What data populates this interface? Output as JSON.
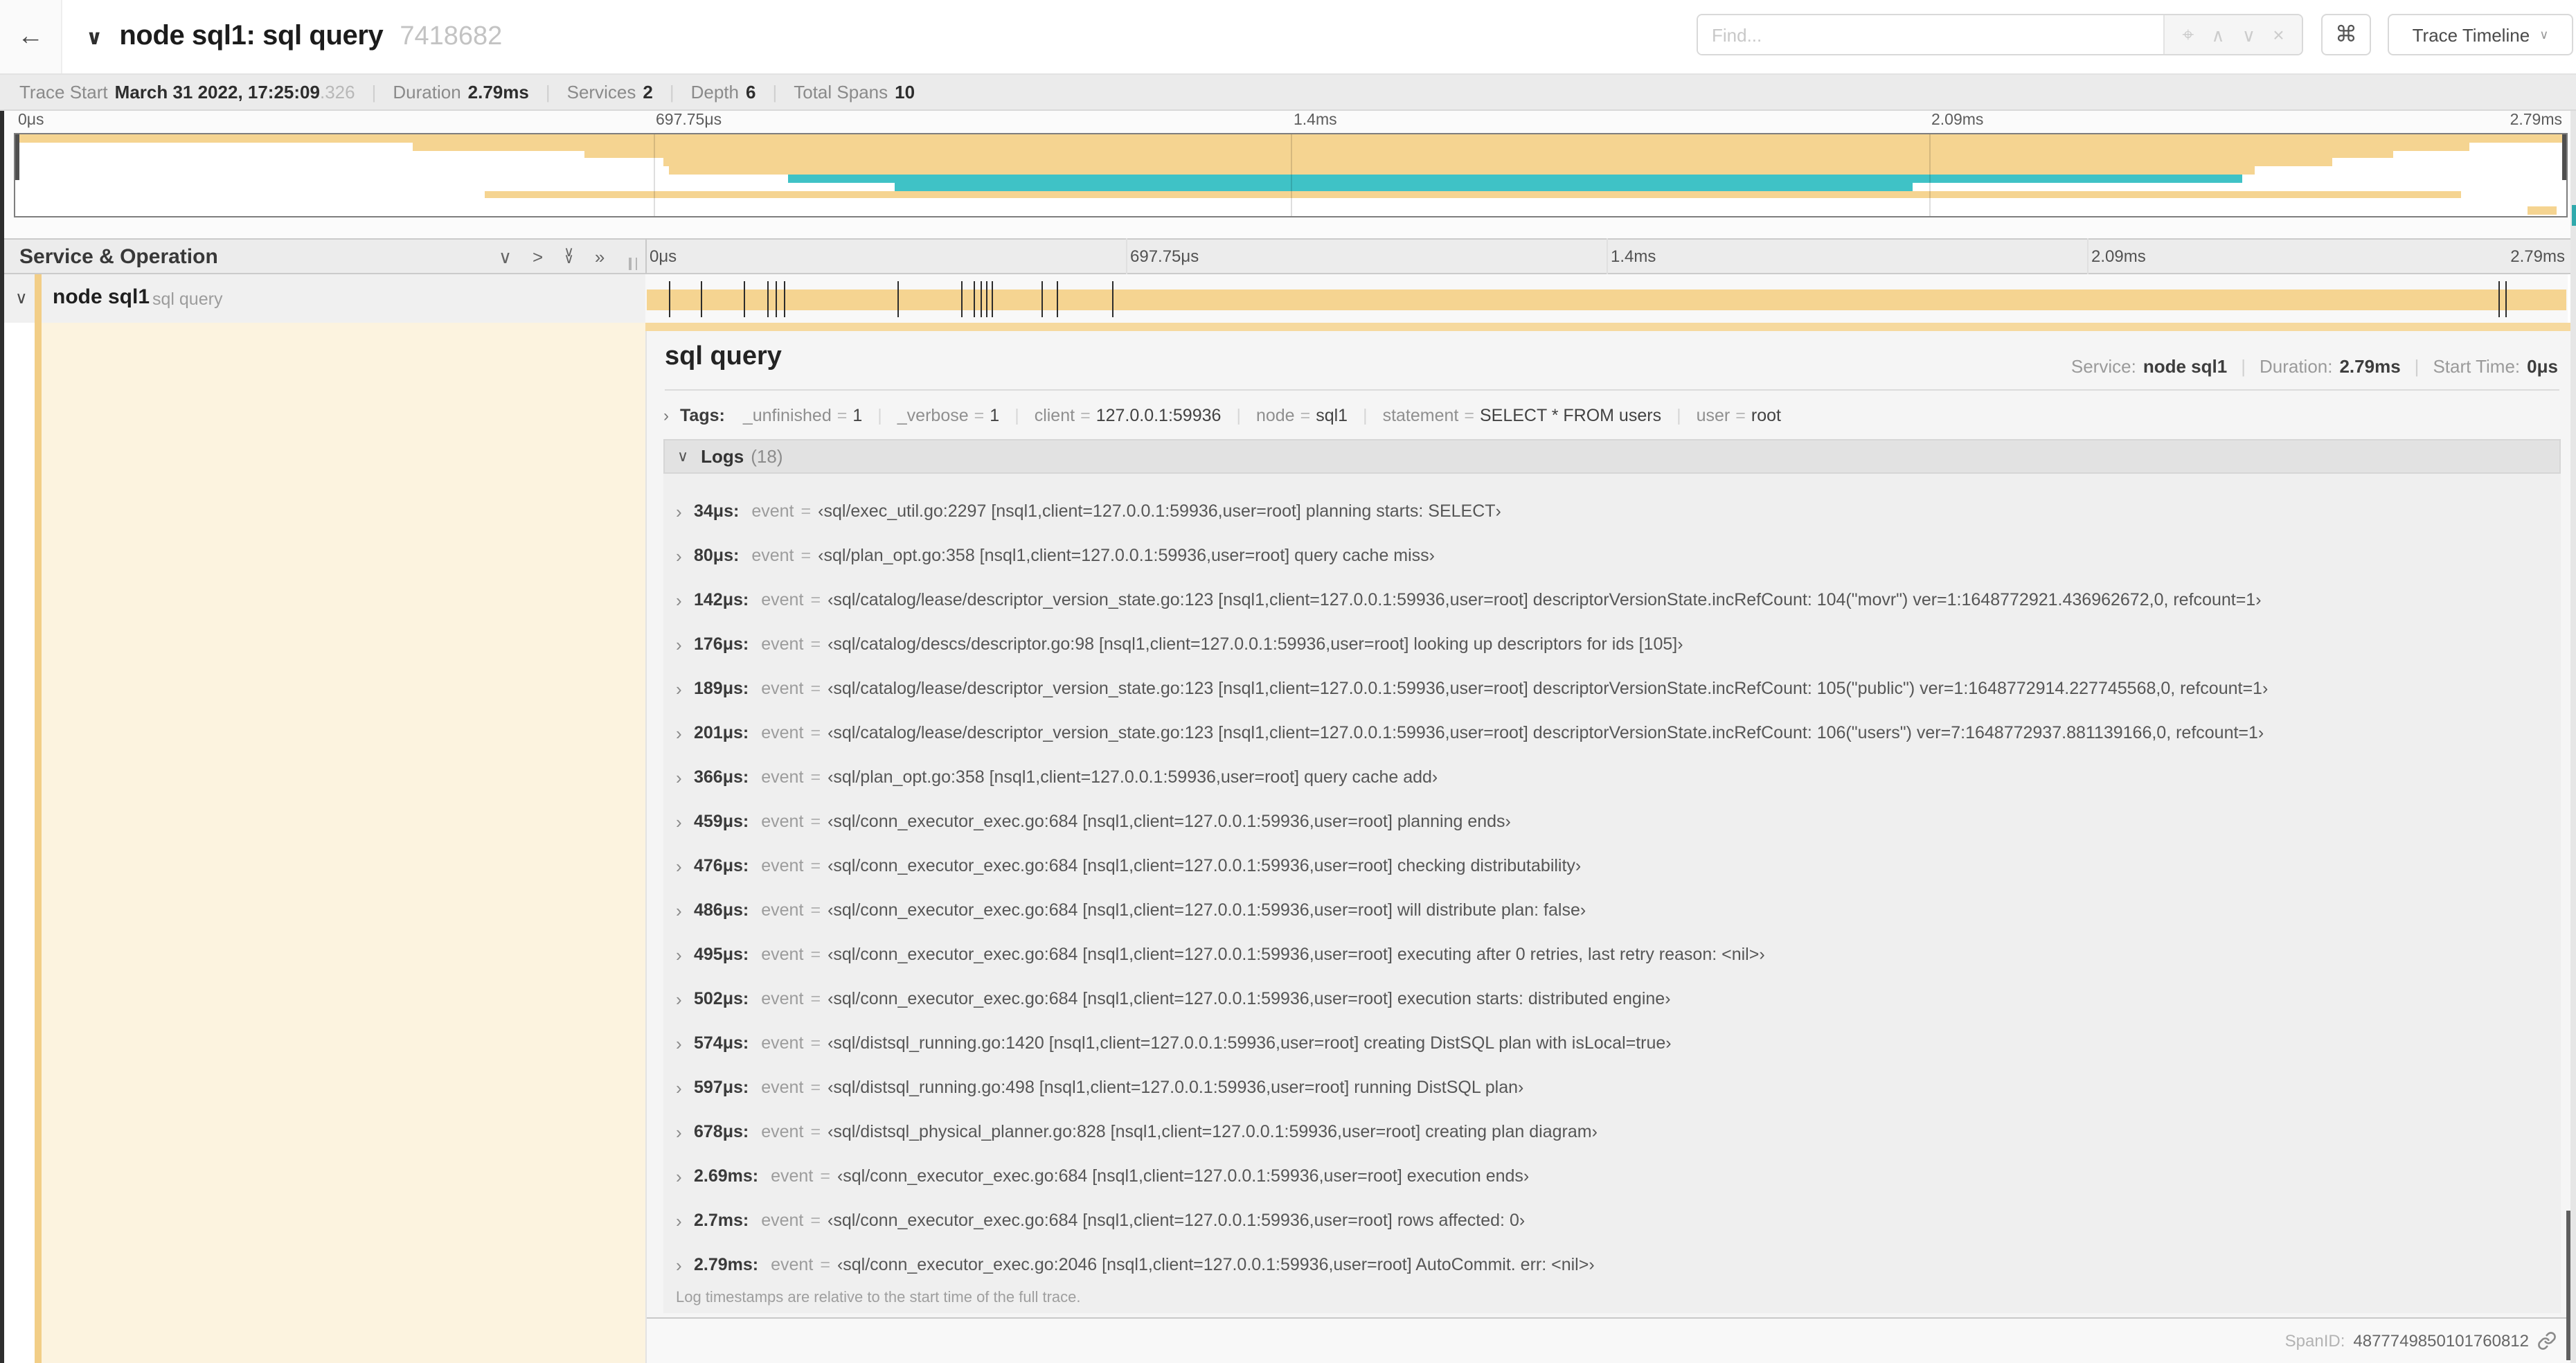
{
  "icons": {
    "back": "←",
    "collapse": "∨",
    "chevron_right": "›",
    "expand_right": ">",
    "double_chevron_right": "»",
    "locate": "⌖",
    "up_chevron": "∧",
    "down_chevron": "∨",
    "close": "×",
    "command": "⌘",
    "caret": "∨"
  },
  "header": {
    "title": "node sql1: sql query",
    "trace_id": "7418682",
    "find_placeholder": "Find...",
    "view_selector_label": "Trace Timeline"
  },
  "summary": {
    "items": [
      {
        "label": "Trace Start",
        "value": "March 31 2022, 17:25:09",
        "suffix": ".326"
      },
      {
        "label": "Duration",
        "value": "2.79ms",
        "suffix": ""
      },
      {
        "label": "Services",
        "value": "2",
        "suffix": ""
      },
      {
        "label": "Depth",
        "value": "6",
        "suffix": ""
      },
      {
        "label": "Total Spans",
        "value": "10",
        "suffix": ""
      }
    ]
  },
  "timeline": {
    "duration_us": 2790,
    "tick_labels": [
      "0μs",
      "697.75μs",
      "1.4ms",
      "2.09ms",
      "2.79ms"
    ],
    "log_marks_us": [
      34,
      80,
      142,
      176,
      189,
      201,
      366,
      459,
      476,
      486,
      495,
      502,
      574,
      597,
      678,
      2690,
      2700
    ]
  },
  "minimap": {
    "rows": [
      {
        "s": 0.0,
        "e": 1.0,
        "c": "tan"
      },
      {
        "s": 0.156,
        "e": 0.962,
        "c": "tan"
      },
      {
        "s": 0.223,
        "e": 0.932,
        "c": "tan"
      },
      {
        "s": 0.254,
        "e": 0.908,
        "c": "tan"
      },
      {
        "s": 0.256,
        "e": 0.878,
        "c": "tan"
      },
      {
        "s": 0.303,
        "e": 0.873,
        "c": "teal"
      },
      {
        "s": 0.345,
        "e": 0.744,
        "c": "teal"
      },
      {
        "s": 0.184,
        "e": 0.959,
        "c": "tan"
      },
      {
        "s": 0.0,
        "e": 0.0,
        "c": "none"
      },
      {
        "s": 0.985,
        "e": 0.996,
        "c": "tan"
      }
    ]
  },
  "grid": {
    "left_header_title": "Service & Operation"
  },
  "span_row": {
    "service": "node sql1",
    "operation": "sql query"
  },
  "detail": {
    "title": "sql query",
    "eq_sign": "=",
    "meta": [
      {
        "label": "Service:",
        "value": "node sql1"
      },
      {
        "label": "Duration:",
        "value": "2.79ms"
      },
      {
        "label": "Start Time:",
        "value": "0μs"
      }
    ],
    "tags_label": "Tags:",
    "tags": [
      {
        "key": "_unfinished",
        "value": "1"
      },
      {
        "key": "_verbose",
        "value": "1"
      },
      {
        "key": "client",
        "value": "127.0.0.1:59936"
      },
      {
        "key": "node",
        "value": "sql1"
      },
      {
        "key": "statement",
        "value": "SELECT * FROM users"
      },
      {
        "key": "user",
        "value": "root"
      }
    ],
    "logs_label": "Logs",
    "logs_count": "(18)",
    "log_field": "event",
    "logs": [
      {
        "time": "34μs:",
        "value": "‹sql/exec_util.go:2297 [nsql1,client=127.0.0.1:59936,user=root] planning starts: SELECT›"
      },
      {
        "time": "80μs:",
        "value": "‹sql/plan_opt.go:358 [nsql1,client=127.0.0.1:59936,user=root] query cache miss›"
      },
      {
        "time": "142μs:",
        "value": "‹sql/catalog/lease/descriptor_version_state.go:123 [nsql1,client=127.0.0.1:59936,user=root] descriptorVersionState.incRefCount: 104(\"movr\") ver=1:1648772921.436962672,0, refcount=1›"
      },
      {
        "time": "176μs:",
        "value": "‹sql/catalog/descs/descriptor.go:98 [nsql1,client=127.0.0.1:59936,user=root] looking up descriptors for ids [105]›"
      },
      {
        "time": "189μs:",
        "value": "‹sql/catalog/lease/descriptor_version_state.go:123 [nsql1,client=127.0.0.1:59936,user=root] descriptorVersionState.incRefCount: 105(\"public\") ver=1:1648772914.227745568,0, refcount=1›"
      },
      {
        "time": "201μs:",
        "value": "‹sql/catalog/lease/descriptor_version_state.go:123 [nsql1,client=127.0.0.1:59936,user=root] descriptorVersionState.incRefCount: 106(\"users\") ver=7:1648772937.881139166,0, refcount=1›"
      },
      {
        "time": "366μs:",
        "value": "‹sql/plan_opt.go:358 [nsql1,client=127.0.0.1:59936,user=root] query cache add›"
      },
      {
        "time": "459μs:",
        "value": "‹sql/conn_executor_exec.go:684 [nsql1,client=127.0.0.1:59936,user=root] planning ends›"
      },
      {
        "time": "476μs:",
        "value": "‹sql/conn_executor_exec.go:684 [nsql1,client=127.0.0.1:59936,user=root] checking distributability›"
      },
      {
        "time": "486μs:",
        "value": "‹sql/conn_executor_exec.go:684 [nsql1,client=127.0.0.1:59936,user=root] will distribute plan: false›"
      },
      {
        "time": "495μs:",
        "value": "‹sql/conn_executor_exec.go:684 [nsql1,client=127.0.0.1:59936,user=root] executing after 0 retries, last retry reason: <nil>›"
      },
      {
        "time": "502μs:",
        "value": "‹sql/conn_executor_exec.go:684 [nsql1,client=127.0.0.1:59936,user=root] execution starts: distributed engine›"
      },
      {
        "time": "574μs:",
        "value": "‹sql/distsql_running.go:1420 [nsql1,client=127.0.0.1:59936,user=root] creating DistSQL plan with isLocal=true›"
      },
      {
        "time": "597μs:",
        "value": "‹sql/distsql_running.go:498 [nsql1,client=127.0.0.1:59936,user=root] running DistSQL plan›"
      },
      {
        "time": "678μs:",
        "value": "‹sql/distsql_physical_planner.go:828 [nsql1,client=127.0.0.1:59936,user=root] creating plan diagram›"
      },
      {
        "time": "2.69ms:",
        "value": "‹sql/conn_executor_exec.go:684 [nsql1,client=127.0.0.1:59936,user=root] execution ends›"
      },
      {
        "time": "2.7ms:",
        "value": "‹sql/conn_executor_exec.go:684 [nsql1,client=127.0.0.1:59936,user=root] rows affected: 0›"
      },
      {
        "time": "2.79ms:",
        "value": "‹sql/conn_executor_exec.go:2046 [nsql1,client=127.0.0.1:59936,user=root] AutoCommit. err: <nil>›"
      }
    ],
    "logs_footnote": "Log timestamps are relative to the start time of the full trace.",
    "span_id_label": "SpanID:",
    "span_id": "4877749850101760812"
  },
  "colors": {
    "tan": "#F5D491",
    "teal": "#3FC2C6",
    "cream": "#FCF3DF",
    "accent": "#F2CE87"
  }
}
